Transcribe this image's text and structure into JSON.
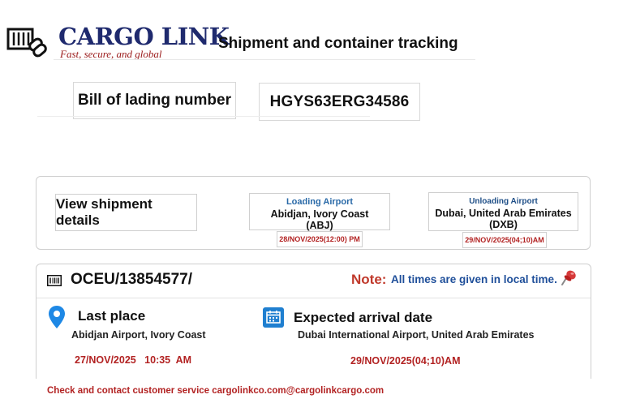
{
  "header": {
    "brand_name": "CARGO LINK",
    "brand_tagline": "Fast, secure, and global",
    "page_title": "Shipment and container tracking",
    "logo_icon": "container-link-icon"
  },
  "bill_of_lading": {
    "label": "Bill of lading number",
    "value": "HGYS63ERG34586"
  },
  "summary": {
    "view_details_label": "View shipment details",
    "loading": {
      "heading": "Loading Airport",
      "name": "Abidjan, Ivory Coast",
      "code": "(ABJ)",
      "datetime": "28/NOV/2025(12:00) PM"
    },
    "unloading": {
      "heading": "Unloading Airport",
      "name": "Dubai, United Arab Emirates",
      "code": "(DXB)",
      "datetime": "29/NOV/2025(04;10)AM"
    }
  },
  "tracking": {
    "container_icon": "barcode-icon",
    "container_number": "OCEU/13854577/",
    "note_label": "Note:",
    "note_text": "All times are given in local time.",
    "note_icon": "pushpin-icon",
    "last_place": {
      "icon": "location-pin-icon",
      "label": "Last place",
      "value": "Abidjan Airport, Ivory Coast",
      "datetime": "27/NOV/2025   10:35  AM"
    },
    "expected_arrival": {
      "icon": "calendar-icon",
      "label": "Expected arrival date",
      "value": "Dubai International Airport, United Arab Emirates",
      "datetime": "29/NOV/2025(04;10)AM"
    }
  },
  "footer": {
    "contact_text": "Check and contact customer service cargolinkco.com@cargolinkcargo.com"
  },
  "colors": {
    "brand_navy": "#1f2a6e",
    "tagline_red": "#9a1a1a",
    "date_red": "#b22222",
    "note_red": "#c0392b",
    "note_blue": "#1f4f9a",
    "airport_heading_blue": "#2a6aa8",
    "location_pin_blue": "#1e88e5",
    "calendar_blue": "#1f7fd0"
  }
}
